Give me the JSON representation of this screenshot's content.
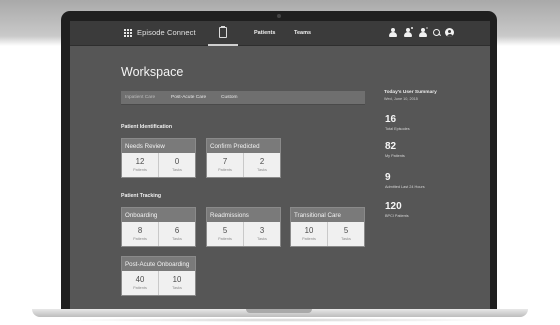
{
  "app": {
    "title": "Episode Connect"
  },
  "nav": {
    "links": [
      "Patients",
      "Teams"
    ]
  },
  "workspace": {
    "title": "Workspace",
    "tabs": [
      "Inpatient Care",
      "Post-Acute Care",
      "Custom"
    ],
    "active_tab": "Inpatient Care"
  },
  "patient_identification": {
    "label": "Patient Identification",
    "cards": [
      {
        "title": "Needs Review",
        "patients": "12",
        "tasks": "0",
        "patients_label": "Patients",
        "tasks_label": "Tasks"
      },
      {
        "title": "Confirm Predicted",
        "patients": "7",
        "tasks": "2",
        "patients_label": "Patients",
        "tasks_label": "Tasks"
      }
    ]
  },
  "patient_tracking": {
    "label": "Patient Tracking",
    "cards": [
      {
        "title": "Onboarding",
        "patients": "8",
        "tasks": "6",
        "patients_label": "Patients",
        "tasks_label": "Tasks"
      },
      {
        "title": "Readmissions",
        "patients": "5",
        "tasks": "3",
        "patients_label": "Patients",
        "tasks_label": "Tasks"
      },
      {
        "title": "Transitional Care",
        "patients": "10",
        "tasks": "5",
        "patients_label": "Patients",
        "tasks_label": "Tasks"
      },
      {
        "title": "Post-Acute Onboarding",
        "patients": "40",
        "tasks": "10",
        "patients_label": "Patients",
        "tasks_label": "Tasks"
      }
    ]
  },
  "summary": {
    "title": "Today's User Summary",
    "date": "Wed, June 10, 2015",
    "items": [
      {
        "value": "16",
        "label": "Total Episodes"
      },
      {
        "value": "82",
        "label": "My Patients"
      },
      {
        "value": "9",
        "label": "Admitted Last 24 Hours"
      },
      {
        "value": "120",
        "label": "BPCI Patients"
      }
    ]
  },
  "colors": {
    "screen_bg": "#565656",
    "nav_bg": "#3b3b3b",
    "card_header": "#7a7a7a",
    "card_body": "#f0f0f0"
  },
  "icons": [
    "grid-icon",
    "clipboard-icon",
    "users-icon",
    "add-user-icon",
    "notification-icon",
    "search-icon",
    "avatar-icon"
  ]
}
